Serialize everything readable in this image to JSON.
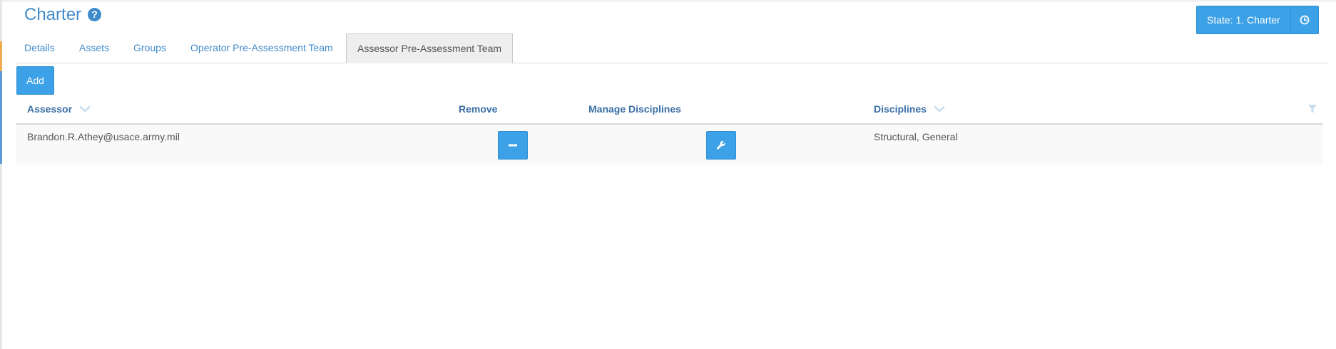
{
  "header": {
    "title": "Charter",
    "help_icon": "question-circle-icon",
    "state_label": "State: 1. Charter",
    "history_icon": "clock-icon"
  },
  "tabs": [
    {
      "label": "Details",
      "active": false
    },
    {
      "label": "Assets",
      "active": false
    },
    {
      "label": "Groups",
      "active": false
    },
    {
      "label": "Operator Pre-Assessment Team",
      "active": false
    },
    {
      "label": "Assessor Pre-Assessment Team",
      "active": true
    }
  ],
  "toolbar": {
    "add_label": "Add"
  },
  "grid": {
    "columns": {
      "assessor": "Assessor",
      "remove": "Remove",
      "manage": "Manage Disciplines",
      "disciplines": "Disciplines"
    },
    "rows": [
      {
        "assessor": "Brandon.R.Athey@usace.army.mil",
        "remove_icon": "minus-icon",
        "manage_icon": "wrench-icon",
        "disciplines": "Structural, General"
      }
    ]
  },
  "colors": {
    "accent": "#3ca1e6",
    "link": "#428bca",
    "header_text": "#3a6ea5"
  }
}
